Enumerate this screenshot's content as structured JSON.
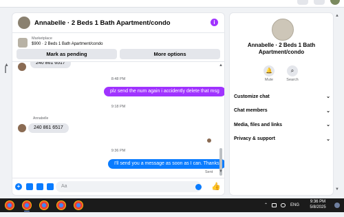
{
  "chat": {
    "title": "Annabelle · 2 Beds 1 Bath Apartment/condo",
    "listing": {
      "marketplace_label": "Marketplace",
      "price_title": "$900 · 2 Beds 1 Bath Apartment/condo"
    },
    "buttons": {
      "pending": "Mark as pending",
      "more": "More options"
    }
  },
  "messages": {
    "partial_in": "240 861 6517",
    "time1": "8:48 PM",
    "out1": "plz send the num again i accidently delete that msg",
    "time2": "9:18 PM",
    "sender": "Annabelle",
    "in1": "240 861 6517",
    "time3": "9:36 PM",
    "out2": "I'll send you a message as soon as I can. Thanks",
    "status": "Sent"
  },
  "composer": {
    "placeholder": "Aa"
  },
  "info_panel": {
    "title": "Annabelle · 2 Beds 1 Bath Apartment/condo",
    "actions": [
      {
        "label": "Mute",
        "icon": "bell-icon"
      },
      {
        "label": "Search",
        "icon": "search-icon"
      }
    ],
    "sections": [
      "Customize chat",
      "Chat members",
      "Media, files and links",
      "Privacy & support"
    ]
  },
  "taskbar": {
    "language": "ENG",
    "time": "9:36 PM",
    "date": "5/8/2025"
  },
  "colors": {
    "accent_purple": "#a033ff",
    "accent_blue": "#0a7cff"
  }
}
